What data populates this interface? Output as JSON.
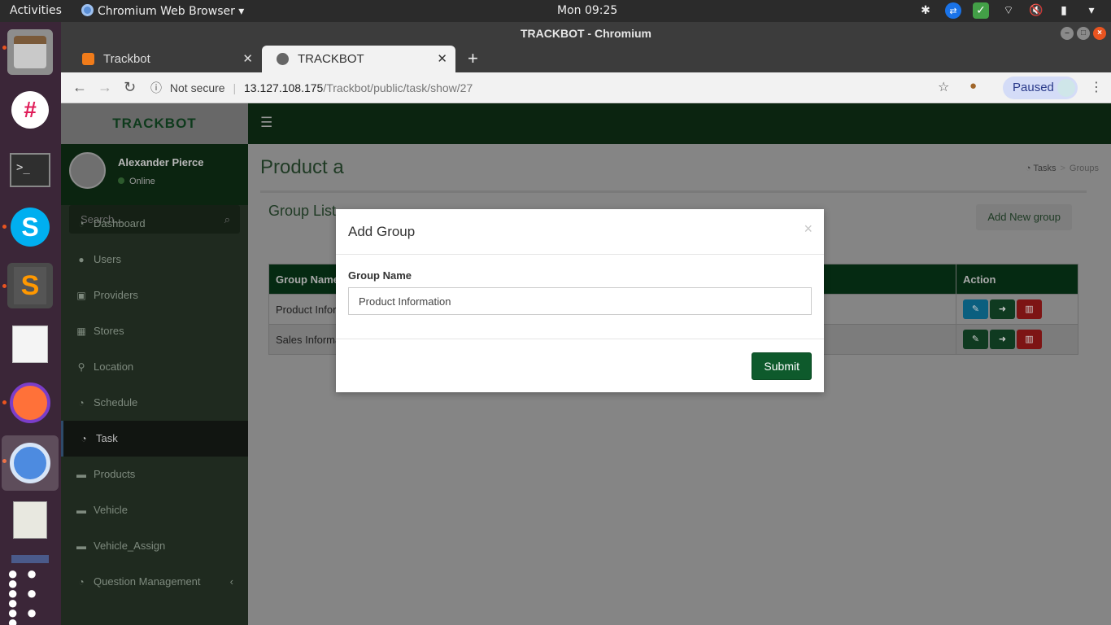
{
  "topbar": {
    "activities": "Activities",
    "app_name": "Chromium Web Browser ▾",
    "clock": "Mon 09:25"
  },
  "dock": {
    "apps": [
      "files-icon",
      "slack-icon",
      "terminal-icon",
      "skype-icon",
      "sublime-icon",
      "text-editor-icon",
      "firefox-icon",
      "chromium-icon",
      "system-monitor-icon",
      "drive-icon",
      "app-grid-icon"
    ]
  },
  "window": {
    "title": "TRACKBOT - Chromium",
    "tabs": [
      {
        "label": "Trackbot"
      },
      {
        "label": "TRACKBOT"
      }
    ],
    "address": {
      "security": "Not secure",
      "host": "13.127.108.175",
      "path": "/Trackbot/public/task/show/27"
    },
    "profile_label": "Paused"
  },
  "app": {
    "logo": "TRACKBOT",
    "user": {
      "name": "Alexander Pierce",
      "status": "Online"
    },
    "search_placeholder": "Search...",
    "menu": [
      {
        "label": "Dashboard",
        "icon": "dashboard-icon"
      },
      {
        "label": "Users",
        "icon": "user-icon"
      },
      {
        "label": "Providers",
        "icon": "lock-icon"
      },
      {
        "label": "Stores",
        "icon": "building-icon"
      },
      {
        "label": "Location",
        "icon": "map-marker-icon"
      },
      {
        "label": "Schedule",
        "icon": "dashboard-icon"
      },
      {
        "label": "Task",
        "icon": "dashboard-icon"
      },
      {
        "label": "Products",
        "icon": "car-icon"
      },
      {
        "label": "Vehicle",
        "icon": "car-icon"
      },
      {
        "label": "Vehicle_Assign",
        "icon": "car-icon"
      },
      {
        "label": "Question Management",
        "icon": "dashboard-icon"
      }
    ],
    "page_title": "Product a",
    "breadcrumb": {
      "first": "Tasks",
      "last": "Groups"
    },
    "box_title": "Group List",
    "add_button": "Add New group",
    "table": {
      "headers": [
        "Group Name",
        "Action"
      ],
      "rows": [
        {
          "name": "Product Information"
        },
        {
          "name": "Sales Information"
        }
      ]
    }
  },
  "modal": {
    "title": "Add Group",
    "close": "×",
    "field_label": "Group Name",
    "field_value": "Product Information",
    "submit": "Submit"
  }
}
